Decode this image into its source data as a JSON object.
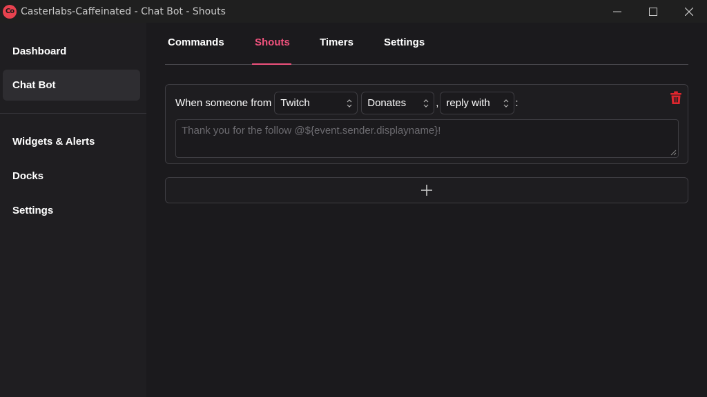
{
  "window": {
    "app_icon_text": "Co",
    "title": "Casterlabs-Caffeinated - Chat Bot - Shouts"
  },
  "sidebar": {
    "items": [
      {
        "label": "Dashboard",
        "active": false
      },
      {
        "label": "Chat Bot",
        "active": true
      },
      {
        "label": "Widgets & Alerts",
        "active": false
      },
      {
        "label": "Docks",
        "active": false
      },
      {
        "label": "Settings",
        "active": false
      }
    ]
  },
  "tabs": [
    {
      "label": "Commands",
      "active": false
    },
    {
      "label": "Shouts",
      "active": true
    },
    {
      "label": "Timers",
      "active": false
    },
    {
      "label": "Settings",
      "active": false
    }
  ],
  "shout": {
    "prefix": "When someone from",
    "platform": "Twitch",
    "event": "Donates",
    "separator": ",",
    "action": "reply with",
    "suffix": ":",
    "message_placeholder": "Thank you for the follow @${event.sender.displayname}!"
  },
  "colors": {
    "accent": "#f0527d",
    "delete": "#e0262e",
    "background": "#1b1a1d",
    "sidebar": "#1f1e21"
  },
  "icons": {
    "delete": "trash-icon",
    "add": "plus-icon"
  }
}
